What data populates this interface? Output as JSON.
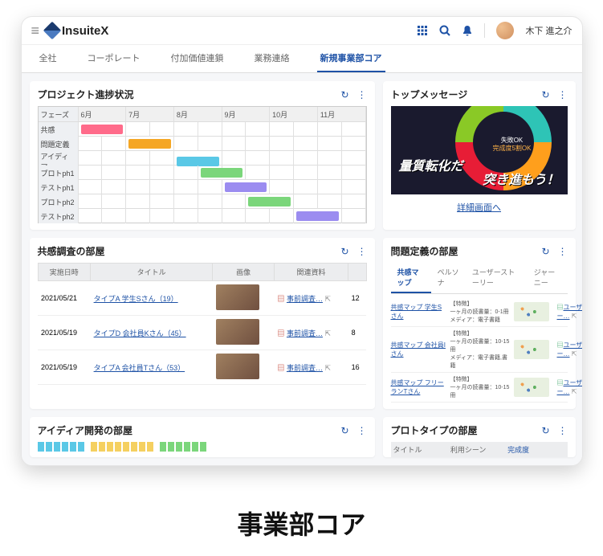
{
  "brand": "InsuiteX",
  "user": "木下 進之介",
  "nav_tabs": [
    "全社",
    "コーポレート",
    "付加価値連鎖",
    "業務連絡",
    "新規事業部コア"
  ],
  "active_tab": 4,
  "project_card": {
    "title": "プロジェクト進捗状況",
    "phase_label": "フェーズ",
    "months": [
      "6月",
      "7月",
      "8月",
      "9月",
      "10月",
      "11月"
    ],
    "rows": [
      {
        "label": "共感",
        "start": 0,
        "span": 2,
        "color": "#ff6b8a"
      },
      {
        "label": "問題定義",
        "start": 2,
        "span": 2,
        "color": "#f5a623"
      },
      {
        "label": "アイディア",
        "start": 4,
        "span": 2,
        "color": "#5ac8e6"
      },
      {
        "label": "プロトph1",
        "start": 5,
        "span": 2,
        "color": "#7bd67b"
      },
      {
        "label": "テストph1",
        "start": 6,
        "span": 2,
        "color": "#9b8cf0"
      },
      {
        "label": "プロトph2",
        "start": 7,
        "span": 2,
        "color": "#7bd67b"
      },
      {
        "label": "テストph2",
        "start": 9,
        "span": 2,
        "color": "#9b8cf0"
      }
    ]
  },
  "topmsg": {
    "title": "トップメッセージ",
    "badge1": "失敗OK",
    "badge2": "完成度5割OK",
    "slogan1": "量質転化だ",
    "slogan2": "突き進もう！",
    "link": "詳細画面へ"
  },
  "empathy": {
    "title": "共感調査の部屋",
    "cols": [
      "実施日時",
      "タイトル",
      "画像",
      "関連資料",
      ""
    ],
    "rows": [
      {
        "date": "2021/05/21",
        "title": "タイプA 学生Sさん（19）",
        "file": "事前調査…",
        "count": "12"
      },
      {
        "date": "2021/05/19",
        "title": "タイプD 会社員Kさん（45）",
        "file": "事前調査…",
        "count": "8"
      },
      {
        "date": "2021/05/19",
        "title": "タイプA 会社員Tさん（53）",
        "file": "事前調査…",
        "count": "16"
      }
    ]
  },
  "problem": {
    "title": "問題定義の部屋",
    "subtabs": [
      "共感マップ",
      "ペルソナ",
      "ユーザーストーリー",
      "ジャーニー"
    ],
    "rows": [
      {
        "name": "共感マップ 学生Sさん",
        "meta": "【特徴】\n一ヶ月の読書量：0-1冊\nメディア：電子書籍",
        "link": "ユーザー…"
      },
      {
        "name": "共感マップ 会社員Iさん",
        "meta": "【特徴】\n一ヶ月の読書量：10-15冊\nメディア：電子書籍,書籍",
        "link": "ユーザー…"
      },
      {
        "name": "共感マップ フリーランTさん",
        "meta": "【特徴】\n一ヶ月の読書量：10-15冊",
        "link": "ユーザー…"
      }
    ]
  },
  "idea": {
    "title": "アイディア開発の部屋"
  },
  "proto": {
    "title": "プロトタイプの部屋",
    "cols": [
      "タイトル",
      "利用シーン",
      "完成度"
    ]
  },
  "caption": "事業部コア"
}
